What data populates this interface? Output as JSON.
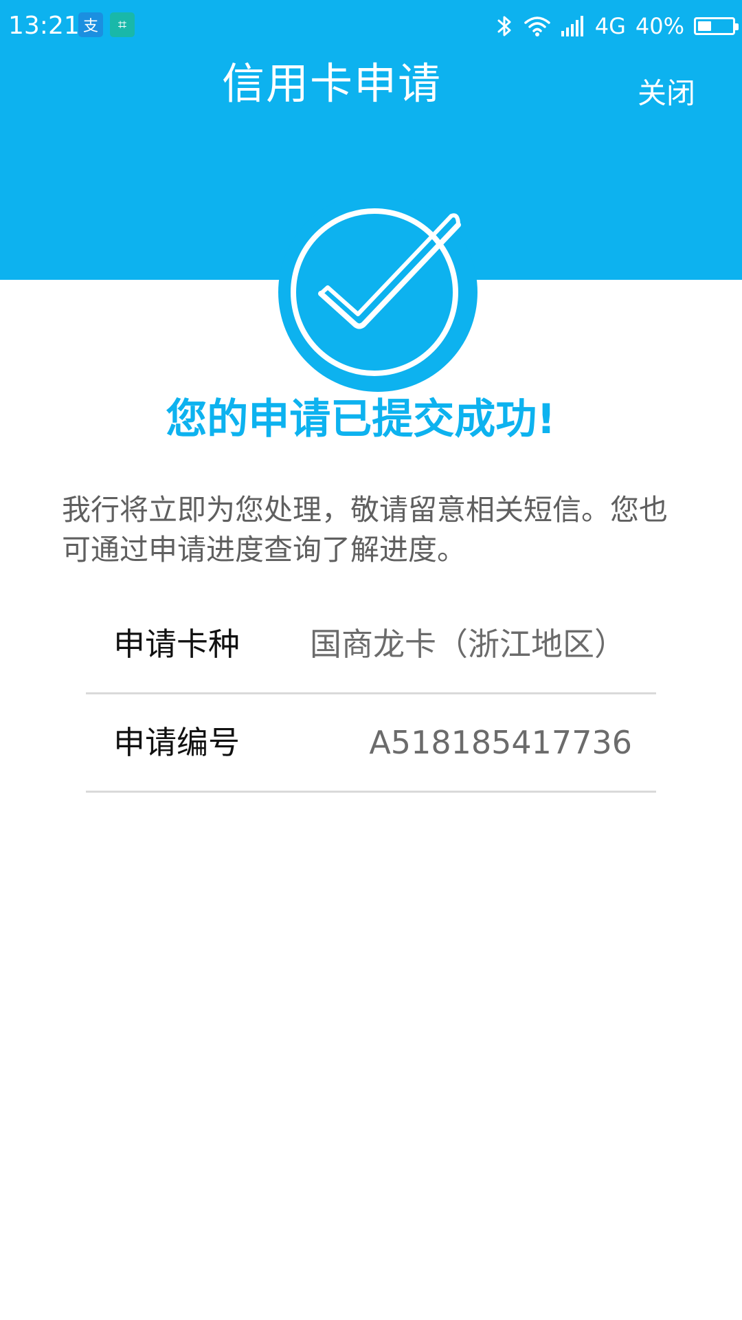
{
  "status_bar": {
    "time": "13:21",
    "app_icons": [
      "alipay-icon",
      "scan-icon"
    ],
    "alipay_glyph": "支",
    "scan_glyph": "⌗",
    "network": "4G",
    "battery_percent": "40%",
    "battery_level": 0.4
  },
  "header": {
    "title": "信用卡申请",
    "close_label": "关闭"
  },
  "success": {
    "icon": "check-circle-icon",
    "message": "您的申请已提交成功!"
  },
  "description": "我行将立即为您处理，敬请留意相关短信。您也可通过申请进度查询了解进度。",
  "details": [
    {
      "label": "申请卡种",
      "value": "国商龙卡（浙江地区）"
    },
    {
      "label": "申请编号",
      "value": "A518185417736"
    }
  ],
  "colors": {
    "primary": "#0db2ef",
    "text_dark": "#111111",
    "text_gray": "#5f5f5f",
    "divider": "#d9d9d9"
  }
}
